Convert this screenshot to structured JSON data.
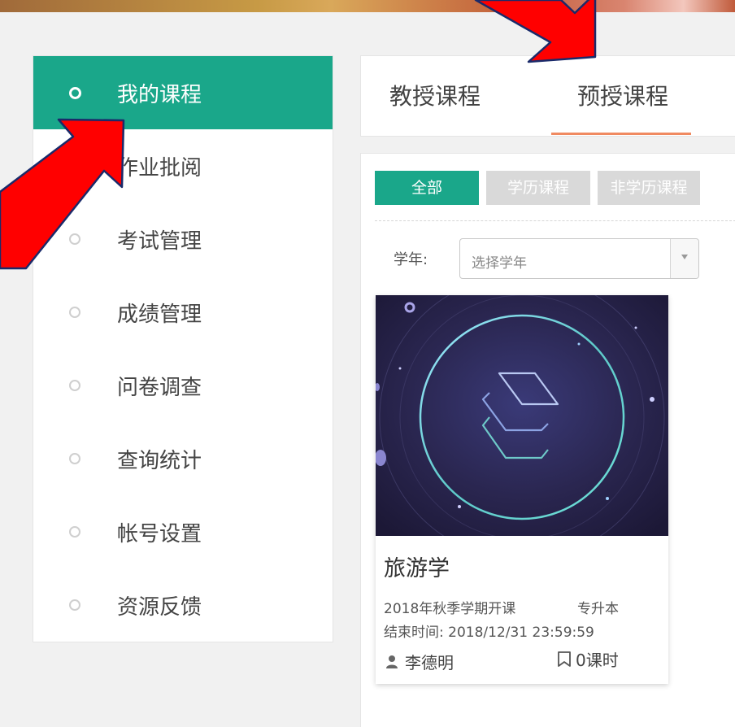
{
  "sidebar": {
    "items": [
      {
        "label": "我的课程",
        "active": true
      },
      {
        "label": "作业批阅",
        "active": false
      },
      {
        "label": "考试管理",
        "active": false
      },
      {
        "label": "成绩管理",
        "active": false
      },
      {
        "label": "问卷调查",
        "active": false
      },
      {
        "label": "查询统计",
        "active": false
      },
      {
        "label": "帐号设置",
        "active": false
      },
      {
        "label": "资源反馈",
        "active": false
      }
    ]
  },
  "tabs": {
    "items": [
      {
        "label": "教授课程",
        "active": false
      },
      {
        "label": "预授课程",
        "active": true
      }
    ]
  },
  "filters": {
    "items": [
      {
        "label": "全部",
        "active": true
      },
      {
        "label": "学历课程",
        "active": false
      },
      {
        "label": "非学历课程",
        "active": false
      }
    ]
  },
  "year_filter": {
    "label": "学年:",
    "placeholder": "选择学年"
  },
  "course": {
    "name": "旅游学",
    "term": "2018年秋季学期开课",
    "type": "专升本",
    "end_time": "结束时间: 2018/12/31 23:59:59",
    "teacher": "李德明",
    "hours": "0课时"
  },
  "colors": {
    "accent": "#1aa78a",
    "tab_underline": "#f08a61",
    "arrow": "#ff0000",
    "inactive_filter": "#d9d9d9"
  },
  "icons": {
    "user": "user-icon",
    "hours": "bookmark-icon",
    "caret": "chevron-down-icon"
  }
}
